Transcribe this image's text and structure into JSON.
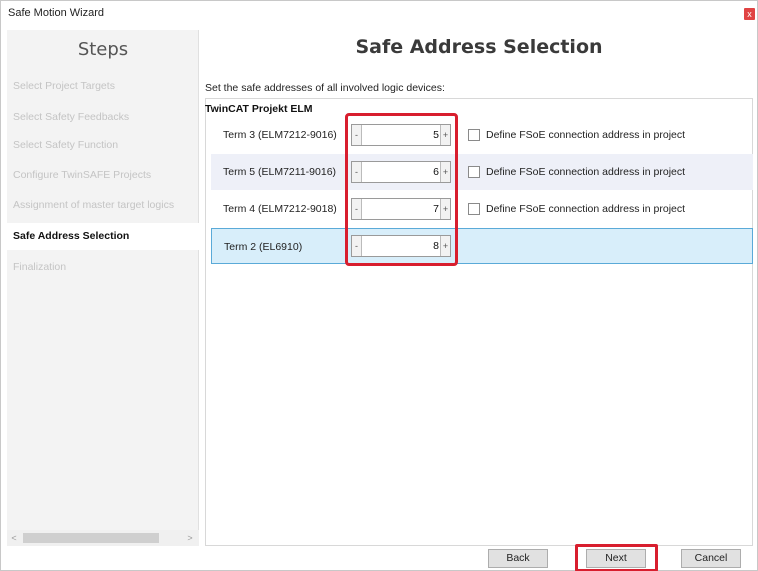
{
  "window": {
    "title": "Safe Motion Wizard",
    "close_label": "x"
  },
  "sidebar": {
    "header": "Steps",
    "items": [
      {
        "label": "Select Project Targets",
        "active": false
      },
      {
        "label": "Select Safety Feedbacks",
        "active": false
      },
      {
        "label": "Select Safety Function",
        "active": false
      },
      {
        "label": "Configure TwinSAFE Projects",
        "active": false
      },
      {
        "label": "Assignment of master target logics",
        "active": false
      },
      {
        "label": "Safe Address Selection",
        "active": true
      },
      {
        "label": "Finalization",
        "active": false
      }
    ],
    "scroll_left": "<",
    "scroll_right": ">"
  },
  "main": {
    "title": "Safe Address Selection",
    "instruction": "Set the safe addresses of all involved logic devices:",
    "project_title": "TwinCAT Projekt ELM",
    "rows": [
      {
        "label": "Term 3 (ELM7212-9016)",
        "value": "5",
        "minus": "-",
        "plus": "+",
        "has_checkbox": true,
        "checkbox_label": "Define FSoE connection address in project",
        "checked": false
      },
      {
        "label": "Term 5 (ELM7211-9016)",
        "value": "6",
        "minus": "-",
        "plus": "+",
        "has_checkbox": true,
        "checkbox_label": "Define FSoE connection address in project",
        "checked": false
      },
      {
        "label": "Term 4 (ELM7212-9018)",
        "value": "7",
        "minus": "-",
        "plus": "+",
        "has_checkbox": true,
        "checkbox_label": "Define FSoE connection address in project",
        "checked": false
      },
      {
        "label": "Term 2 (EL6910)",
        "value": "8",
        "minus": "-",
        "plus": "+",
        "has_checkbox": false,
        "selected": true
      }
    ]
  },
  "footer": {
    "back_label": "Back",
    "next_label": "Next",
    "cancel_label": "Cancel"
  },
  "colors": {
    "highlight": "#d81e2e",
    "selected_row": "#d8eefa",
    "alt_row": "#eef0f8"
  }
}
